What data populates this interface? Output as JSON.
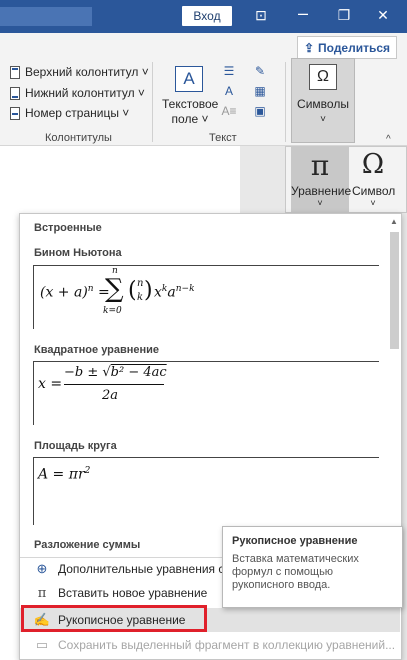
{
  "titlebar": {
    "login_label": "Вход",
    "share_label": "Поделиться"
  },
  "ribbon": {
    "header_footer": {
      "items": [
        {
          "label": "Верхний колонтитул ˅"
        },
        {
          "label": "Нижний колонтитул ˅"
        },
        {
          "label": "Номер страницы ˅"
        }
      ],
      "group_label": "Колонтитулы"
    },
    "text": {
      "textbox_label_1": "Текстовое",
      "textbox_label_2": "поле ˅",
      "group_label": "Текст"
    },
    "symbols": {
      "label": "Символы",
      "chevron": "˅"
    }
  },
  "symbols_dropdown": {
    "equation_label": "Уравнение",
    "symbol_label": "Символ",
    "equation_glyph": "π",
    "symbol_glyph": "Ω"
  },
  "gallery": {
    "section_builtin": "Встроенные",
    "items": [
      {
        "title": "Бином Ньютона"
      },
      {
        "title": "Квадратное уравнение"
      },
      {
        "title": "Площадь круга"
      },
      {
        "title": "Разложение суммы"
      }
    ],
    "menu": [
      {
        "label": "Дополнительные уравнения с са",
        "icon": "globe-icon"
      },
      {
        "label": "Вставить новое уравнение",
        "icon": "pi-icon"
      },
      {
        "label": "Рукописное уравнение",
        "icon": "ink-equation-icon"
      },
      {
        "label": "Сохранить выделенный фрагмент в коллекцию уравнений...",
        "icon": "save-selection-icon"
      }
    ]
  },
  "tooltip": {
    "title": "Рукописное уравнение",
    "body_1": "Вставка математических",
    "body_2": "формул с помощью",
    "body_3": "рукописного ввода."
  },
  "colors": {
    "accent": "#2b579a",
    "highlight": "#e0202b"
  }
}
